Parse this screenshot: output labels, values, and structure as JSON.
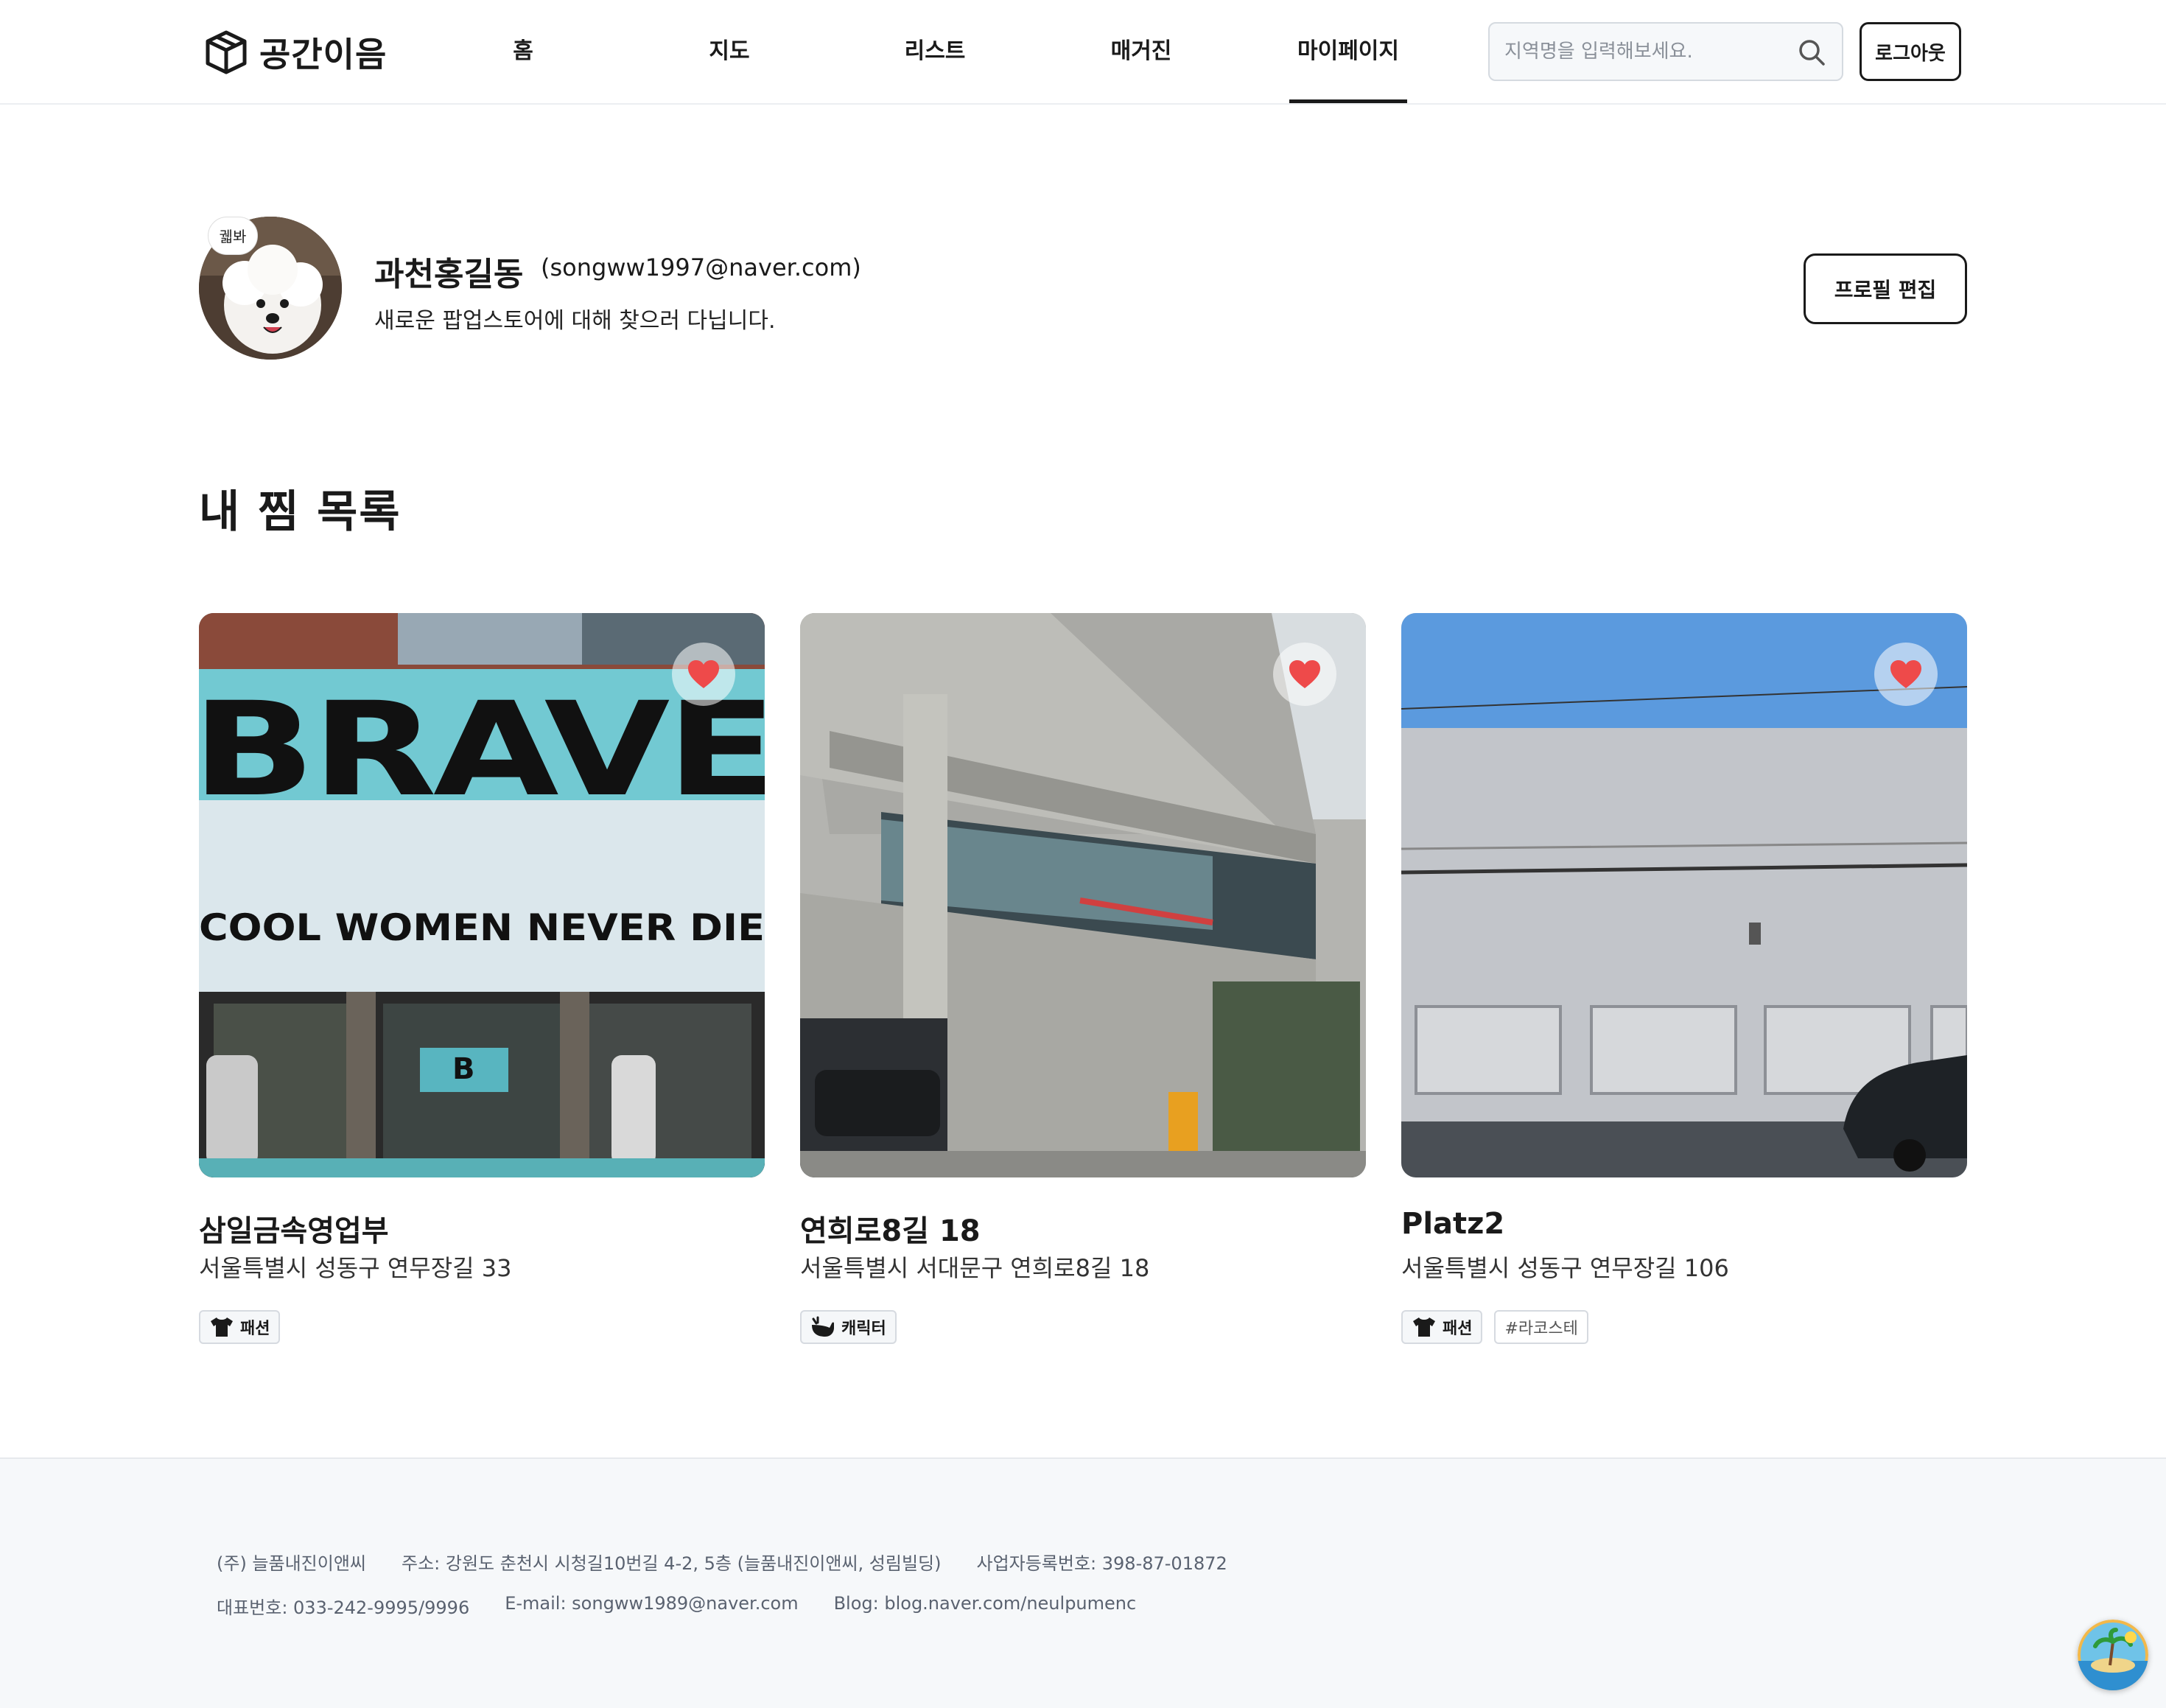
{
  "header": {
    "logo_text": "공간이음",
    "nav": [
      {
        "label": "홈"
      },
      {
        "label": "지도"
      },
      {
        "label": "리스트"
      },
      {
        "label": "매거진"
      },
      {
        "label": "마이페이지",
        "active": true
      }
    ],
    "search_placeholder": "지역명을 입력해보세요.",
    "logout_label": "로그아웃"
  },
  "profile": {
    "avatar_badge": "궯봐",
    "name": "과천홍길동",
    "email": "(songww1997@naver.com)",
    "bio": "새로운 팝업스토어에 대해 찾으러 다닙니다.",
    "edit_label": "프로필 편집"
  },
  "wishlist": {
    "title": "내 찜 목록",
    "cards": [
      {
        "title": "삼일금속영업부",
        "address": "서울특별시 성동구 연무장길 33",
        "tags": [
          {
            "label": "패션",
            "icon": "tshirt-icon"
          }
        ],
        "image_text": {
          "big": "BRAVE",
          "line": "COOL WOMEN NEVER DIE",
          "letter": "B"
        },
        "liked": true
      },
      {
        "title": "연희로8길 18",
        "address": "서울특별시 서대문구 연희로8길 18",
        "tags": [
          {
            "label": "캐릭터",
            "icon": "whale-icon"
          }
        ],
        "liked": true
      },
      {
        "title": "Platz2",
        "address": "서울특별시 성동구 연무장길 106",
        "tags": [
          {
            "label": "패션",
            "icon": "tshirt-icon"
          },
          {
            "label": "#라코스테"
          }
        ],
        "liked": true
      }
    ]
  },
  "footer": {
    "company": "(주) 늘품내진이앤씨",
    "address": "주소: 강원도 춘천시 시청길10번길 4-2, 5층 (늘품내진이앤씨, 성림빌딩)",
    "business_no": "사업자등록번호: 398-87-01872",
    "phone": "대표번호: 033-242-9995/9996",
    "email": "E-mail: songww1989@naver.com",
    "blog": "Blog: blog.naver.com/neulpumenc"
  },
  "colors": {
    "heart": "#ee4a4a",
    "text": "#1a1a1a",
    "footer_bg": "#f6f8fa"
  }
}
